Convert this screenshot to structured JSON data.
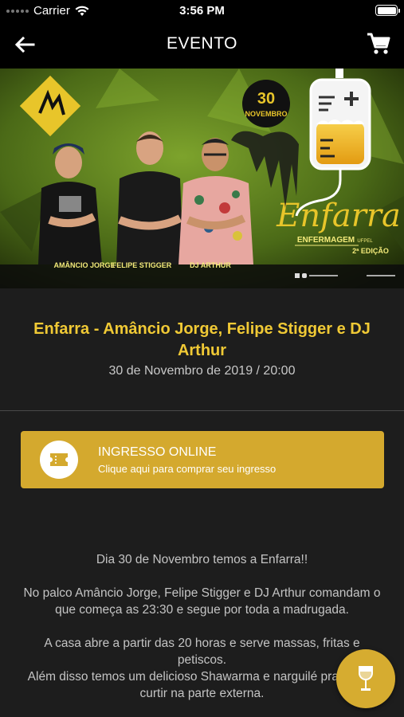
{
  "status_bar": {
    "carrier": "Carrier",
    "time": "3:56 PM",
    "icons": [
      "signal-icon",
      "wifi-icon",
      "battery-icon"
    ]
  },
  "nav": {
    "title": "EVENTO",
    "icons": [
      "back-arrow-icon",
      "cart-icon"
    ]
  },
  "banner": {
    "date_day": "30",
    "date_month": "NOVEMBRO",
    "brand": "Enfarra",
    "tagline": "ENFERMAGEM",
    "tagline_small": "UFPEL",
    "edition": "2ª EDIÇÃO",
    "artists": [
      "AMÂNCIO JORGE",
      "FELIPE STIGGER",
      "DJ ARTHUR"
    ],
    "colors": {
      "background": "#5a7a1e",
      "accent": "#e8c52a"
    }
  },
  "event": {
    "title": "Enfarra - Amâncio Jorge, Felipe Stigger e DJ Arthur",
    "date": "30 de Novembro de 2019 / 20:00"
  },
  "ticket": {
    "title": "INGRESSO ONLINE",
    "subtitle": "Clique aqui para comprar seu ingresso",
    "icon": "ticket-icon",
    "color": "#d4a92e"
  },
  "description": {
    "paragraphs": [
      "Dia 30 de Novembro temos a Enfarra!!",
      "No palco Amâncio Jorge, Felipe Stigger e DJ Arthur comandam o que começa as 23:30 e segue por toda a madrugada.",
      "A casa abre a partir das 20 horas e serve massas, fritas e petiscos.\nAlém disso temos um delicioso Shawarma e narguilé pra galera curtir na parte externa."
    ]
  },
  "fab": {
    "icon": "wine-glass-icon",
    "color": "#d6ac30"
  }
}
